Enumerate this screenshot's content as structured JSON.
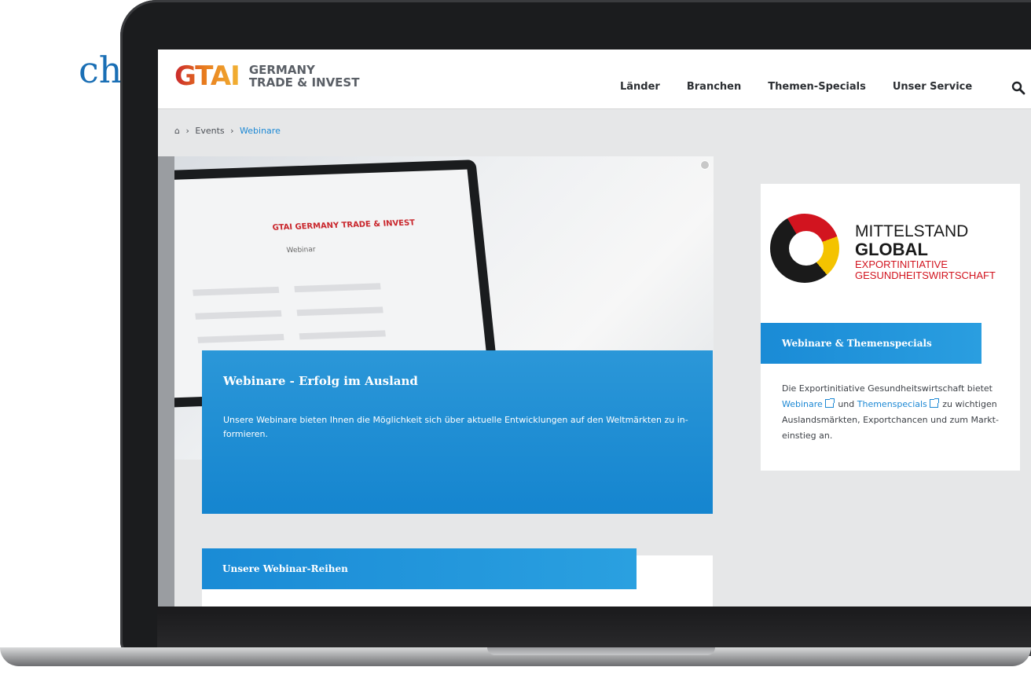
{
  "edge_text": "cht",
  "header": {
    "logo_mark": "GTAI",
    "logo_line1": "GERMANY",
    "logo_line2": "TRADE & INVEST",
    "nav": [
      "Länder",
      "Branchen",
      "Themen-Specials",
      "Unser Service"
    ]
  },
  "breadcrumb": {
    "home_icon": "home-icon",
    "items": [
      "Events",
      "Webinare"
    ]
  },
  "hero": {
    "mock_logo": "GTAI GERMANY TRADE & INVEST",
    "mock_title": "Webinar",
    "title": "Webinare - Erfolg im Ausland",
    "description": "Unsere Webinare bieten Ihnen die Möglichkeit sich über aktuelle Entwicklungen auf den Weltmärkten zu in-formieren."
  },
  "side": {
    "logo_line1": "MITTELSTAND",
    "logo_line2": "GLOBAL",
    "logo_line3": "EXPORTINITIATIVE",
    "logo_line4": "GESUNDHEITSWIRTSCHAFT",
    "band_label": "Webinare & Themenspecials",
    "text_prefix": "Die Exportinitiative Gesundheitswirtschaft bietet",
    "link1": "Webinare",
    "text_mid": "und",
    "link2": "Themenspecials",
    "text_suffix": "zu wichtigen Auslandsmärkten, Exportchancen und zum Markt-einstieg an."
  },
  "reihen": {
    "label": "Unsere Webinar-Reihen"
  },
  "colors": {
    "accent": "#1c88d4",
    "hero_blue": "#1585cf",
    "logo_red": "#c9262c",
    "logo_orange": "#e87b1e",
    "logo_yellow": "#f2b233"
  }
}
